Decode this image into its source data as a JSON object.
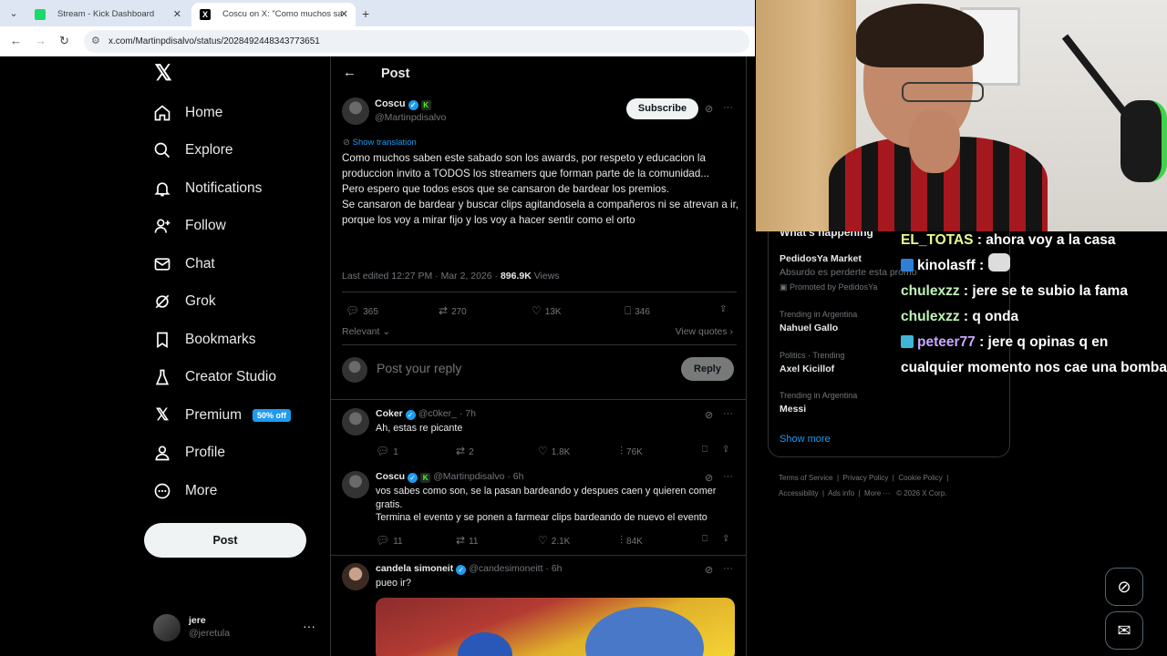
{
  "browser": {
    "tabs": [
      {
        "title": "Stream - Kick Dashboard"
      },
      {
        "title": "Coscu on X: \"Como muchos sa"
      }
    ],
    "url": "x.com/Martinpdisalvo/status/2028492448343773651"
  },
  "sidebar": {
    "items": [
      {
        "label": "Home",
        "icon": "home-icon"
      },
      {
        "label": "Explore",
        "icon": "search-icon"
      },
      {
        "label": "Notifications",
        "icon": "bell-icon"
      },
      {
        "label": "Follow",
        "icon": "add-person-icon"
      },
      {
        "label": "Chat",
        "icon": "mail-icon"
      },
      {
        "label": "Grok",
        "icon": "grok-icon"
      },
      {
        "label": "Bookmarks",
        "icon": "bookmark-icon"
      },
      {
        "label": "Creator Studio",
        "icon": "flask-icon"
      },
      {
        "label": "Premium",
        "icon": "x-icon",
        "badge": "50% off"
      },
      {
        "label": "Profile",
        "icon": "person-icon"
      },
      {
        "label": "More",
        "icon": "more-circle-icon"
      }
    ],
    "post_label": "Post",
    "user": {
      "name": "jere",
      "handle": "@jeretula"
    }
  },
  "header": {
    "title": "Post"
  },
  "tweet": {
    "author": "Coscu",
    "handle": "@Martinpdisalvo",
    "subscribe_label": "Subscribe",
    "translation_label": "Show translation",
    "text": "Como muchos saben este sabado son los awards, por respeto y educacion la produccion invito a TODOS los streamers que forman parte de la comunidad...\nPero espero que todos esos que se cansaron de bardear los premios.\nSe cansaron de bardear y buscar clips agitandosela a compañeros ni se atrevan a ir, porque los voy a mirar fijo y los voy a hacer sentir como el orto",
    "edited": "Last edited 12:27 PM · Mar 2, 2026 · ",
    "views_count": "896.9K",
    "views_label": "Views",
    "stats": {
      "replies": "365",
      "reposts": "270",
      "likes": "13K",
      "bookmarks": "346"
    },
    "sort_label": "Relevant",
    "quotes_label": "View quotes",
    "reply_placeholder": "Post your reply",
    "reply_button": "Reply"
  },
  "replies": [
    {
      "name": "Coker",
      "handle": "@c0ker_ · 7h",
      "text": "Ah, estas re picante",
      "stats": {
        "replies": "1",
        "reposts": "2",
        "likes": "1.8K",
        "views": "76K"
      }
    },
    {
      "name": "Coscu",
      "handle": "@Martinpdisalvo · 6h",
      "text": "vos sabes como son, se la pasan bardeando y despues caen y quieren comer gratis.\nTermina el evento y se ponen a farmear clips bardeando de nuevo el evento",
      "stats": {
        "replies": "11",
        "reposts": "11",
        "likes": "2.1K",
        "views": "84K"
      }
    },
    {
      "name": "candela simoneit",
      "handle": "@candesimoneitt · 6h",
      "text": "pueo ir?"
    }
  ],
  "right": {
    "heading_partial": "What's happening",
    "promo": {
      "name": "PedidosYa Market",
      "sub": "Absurdo es perderte esta promo",
      "promoted": "Promoted by PedidosYa"
    },
    "trends": [
      {
        "label": "Trending in Argentina",
        "name": "Nahuel Gallo"
      },
      {
        "label": "Politics · Trending",
        "name": "Axel Kicillof"
      },
      {
        "label": "Trending in Argentina",
        "name": "Messi"
      }
    ],
    "show_more": "Show more",
    "footer": [
      "Terms of Service",
      "Privacy Policy",
      "Cookie Policy",
      "Accessibility",
      "Ads info",
      "More ···",
      "© 2026 X Corp."
    ]
  },
  "chat": [
    {
      "user": "EL_TOTAS",
      "text": " : ahora voy a la casa",
      "color": "#e8ff8c"
    },
    {
      "user": "kinolasff",
      "text": " : ",
      "color": "#ffffff"
    },
    {
      "user": "chulexzz",
      "text": " : jere se te subio la fama",
      "color": "#bff3b5"
    },
    {
      "user": "chulexzz",
      "text": " : q onda",
      "color": "#bff3b5"
    },
    {
      "user": "peteer77",
      "text": " : jere q opinas q en cualquier momento nos cae una bomba",
      "color": "#c9a7ff"
    }
  ],
  "colors": {
    "accent": "#1d9bf0",
    "background": "#000000",
    "text": "#e7e9ea",
    "muted": "#71767b",
    "kick_green": "#53fc18"
  }
}
